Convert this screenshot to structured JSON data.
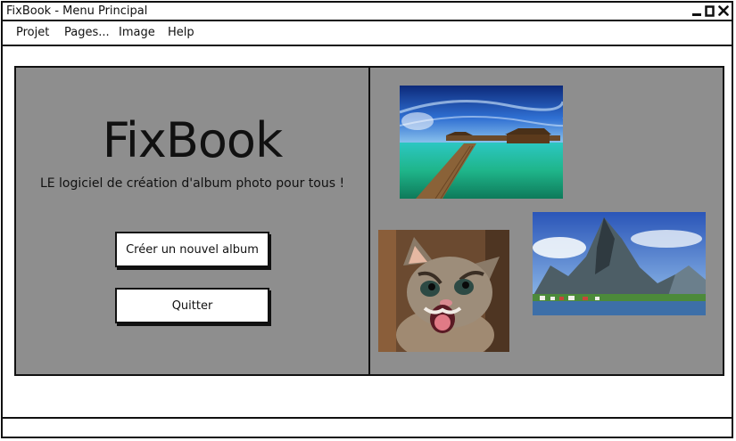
{
  "window": {
    "title": "FixBook - Menu Principal",
    "controls": [
      "minimize-icon",
      "maximize-icon",
      "close-icon"
    ]
  },
  "menu": {
    "items": [
      {
        "label": "Projet"
      },
      {
        "label": "Pages..."
      },
      {
        "label": "Image"
      },
      {
        "label": "Help"
      }
    ]
  },
  "welcome": {
    "app_name": "FixBook",
    "tagline": "LE logiciel de création d'album photo pour tous !",
    "buttons": {
      "new_album": "Créer un nouvel album",
      "quit": "Quitter"
    }
  },
  "gallery": {
    "photos": [
      {
        "subject": "tropical-pier-photo"
      },
      {
        "subject": "kitten-photo"
      },
      {
        "subject": "mountain-lake-photo"
      }
    ]
  },
  "colors": {
    "panel_bg": "#8e8e8e",
    "border": "#111111"
  }
}
